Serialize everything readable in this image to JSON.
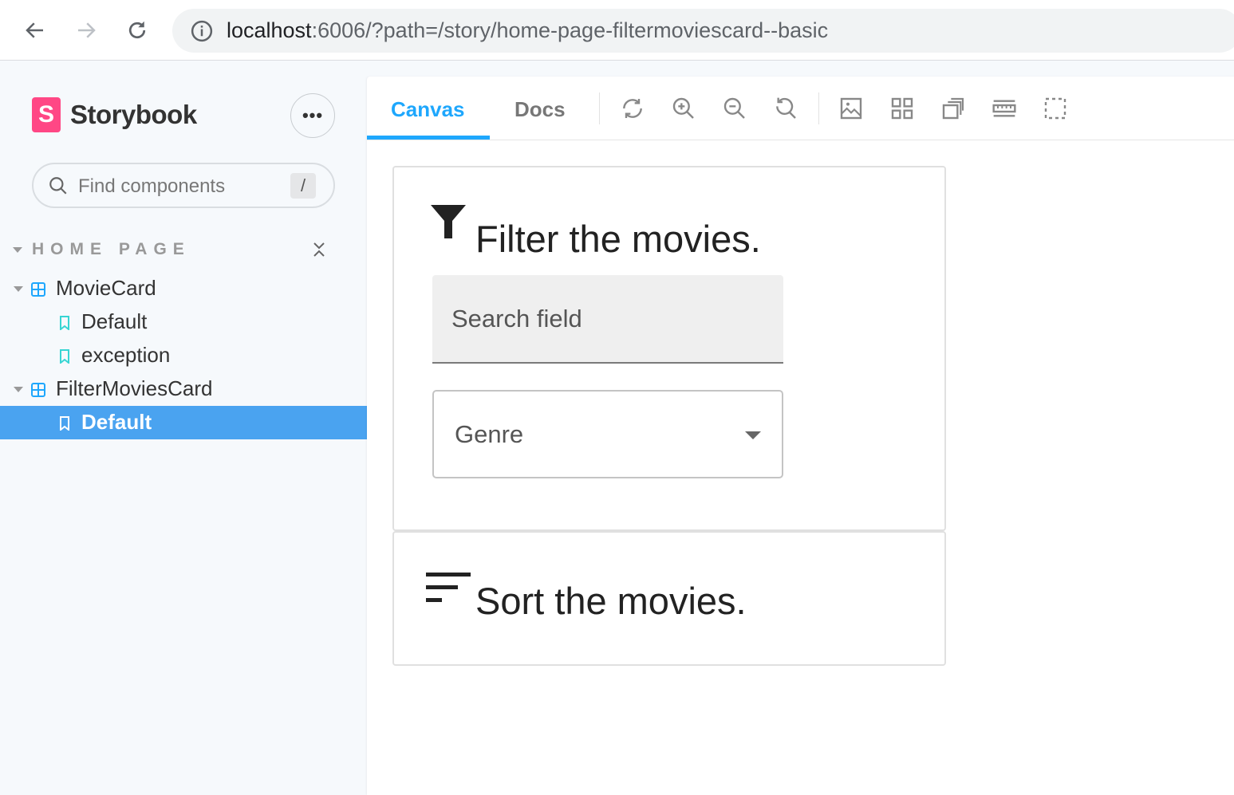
{
  "browser": {
    "url_host": "localhost",
    "url_rest": ":6006/?path=/story/home-page-filtermoviescard--basic"
  },
  "sidebar": {
    "brand": "Storybook",
    "brand_logo_letter": "S",
    "menu_label": "•••",
    "search": {
      "placeholder": "Find components",
      "shortcut": "/"
    },
    "section": "HOME PAGE",
    "items": [
      {
        "label": "MovieCard",
        "type": "component"
      },
      {
        "label": "Default",
        "type": "story"
      },
      {
        "label": "exception",
        "type": "story"
      },
      {
        "label": "FilterMoviesCard",
        "type": "component"
      },
      {
        "label": "Default",
        "type": "story",
        "selected": true
      }
    ]
  },
  "toolbar": {
    "tabs": [
      {
        "label": "Canvas",
        "active": true
      },
      {
        "label": "Docs",
        "active": false
      }
    ],
    "icons": [
      "sync-icon",
      "zoom-in-icon",
      "zoom-out-icon",
      "zoom-reset-icon",
      "background-icon",
      "grid-icon",
      "outline-icon",
      "measure-icon",
      "viewport-icon"
    ]
  },
  "canvas": {
    "filter_card": {
      "title": "Filter the movies.",
      "search_label": "Search field",
      "genre_label": "Genre"
    },
    "sort_card": {
      "title": "Sort the movies."
    }
  },
  "colors": {
    "accent": "#1ea7fd",
    "selected_bg": "#4aa3f0",
    "brand": "#ff4785",
    "story_icon": "#37d5d3",
    "component_icon": "#1ea7fd"
  }
}
